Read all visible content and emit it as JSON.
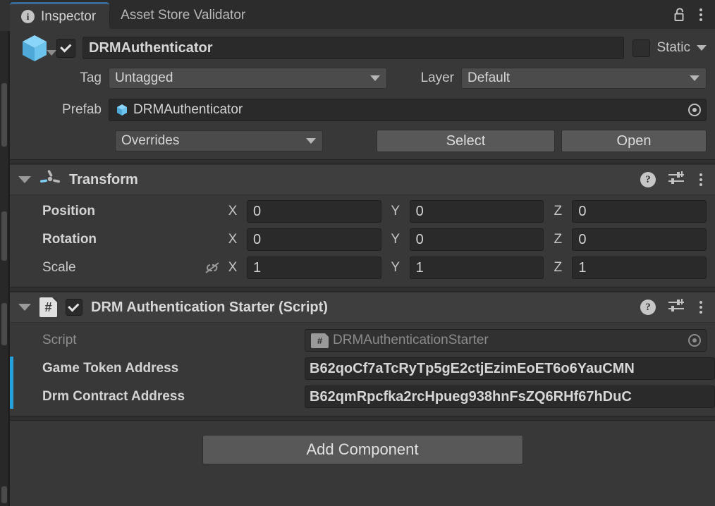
{
  "window": {
    "tabs": [
      {
        "label": "Inspector",
        "icon": "info-icon",
        "active": true
      },
      {
        "label": "Asset Store Validator",
        "icon": "",
        "active": false
      }
    ],
    "lock_icon": "unlocked-padlock-icon",
    "menu_icon": "kebab-menu-icon"
  },
  "gameobject": {
    "enabled_checkbox": true,
    "icon": "prefab-cube-icon",
    "name": "DRMAuthenticator",
    "static_label": "Static",
    "static_checked": false,
    "tag_label": "Tag",
    "tag_value": "Untagged",
    "layer_label": "Layer",
    "layer_value": "Default",
    "prefab_label": "Prefab",
    "prefab_value": "DRMAuthenticator",
    "prefab_icon": "prefab-cube-icon",
    "overrides_label": "Overrides",
    "select_label": "Select",
    "open_label": "Open"
  },
  "transform": {
    "title": "Transform",
    "icon": "transform-gizmo-icon",
    "help_icon": "help-icon",
    "preset_icon": "preset-sliders-icon",
    "menu_icon": "kebab-menu-icon",
    "rows": [
      {
        "label": "Position",
        "overridden": true,
        "link": false,
        "x": "0",
        "y": "0",
        "z": "0"
      },
      {
        "label": "Rotation",
        "overridden": true,
        "link": false,
        "x": "0",
        "y": "0",
        "z": "0"
      },
      {
        "label": "Scale",
        "overridden": false,
        "link": true,
        "x": "1",
        "y": "1",
        "z": "1"
      }
    ],
    "axis_labels": {
      "x": "X",
      "y": "Y",
      "z": "Z"
    },
    "link_icon": "broken-link-icon"
  },
  "script_component": {
    "title": "DRM Authentication Starter (Script)",
    "icon": "csharp-script-icon",
    "enabled_checkbox": true,
    "help_icon": "help-icon",
    "preset_icon": "preset-sliders-icon",
    "menu_icon": "kebab-menu-icon",
    "script_label": "Script",
    "script_value": "DRMAuthenticationStarter",
    "properties": [
      {
        "label": "Game Token Address",
        "value": "B62qoCf7aTcRyTp5gE2ctjEzimEoET6o6YauCMN"
      },
      {
        "label": "Drm Contract Address",
        "value": "B62qmRpcfka2rcHpueg938hnFsZQ6RHf67hDuC"
      }
    ],
    "override_color": "#26a0da"
  },
  "footer": {
    "add_component_label": "Add Component"
  },
  "colors": {
    "panel_bg": "#383838",
    "header_bg": "#3e3e3e",
    "tabbar_bg": "#2c2c2c",
    "field_bg": "#2a2a2a",
    "button_bg": "#585858",
    "accent_blue": "#26a0da",
    "tab_accent": "#3d6a94",
    "cube_blue": "#7fd0f7"
  }
}
